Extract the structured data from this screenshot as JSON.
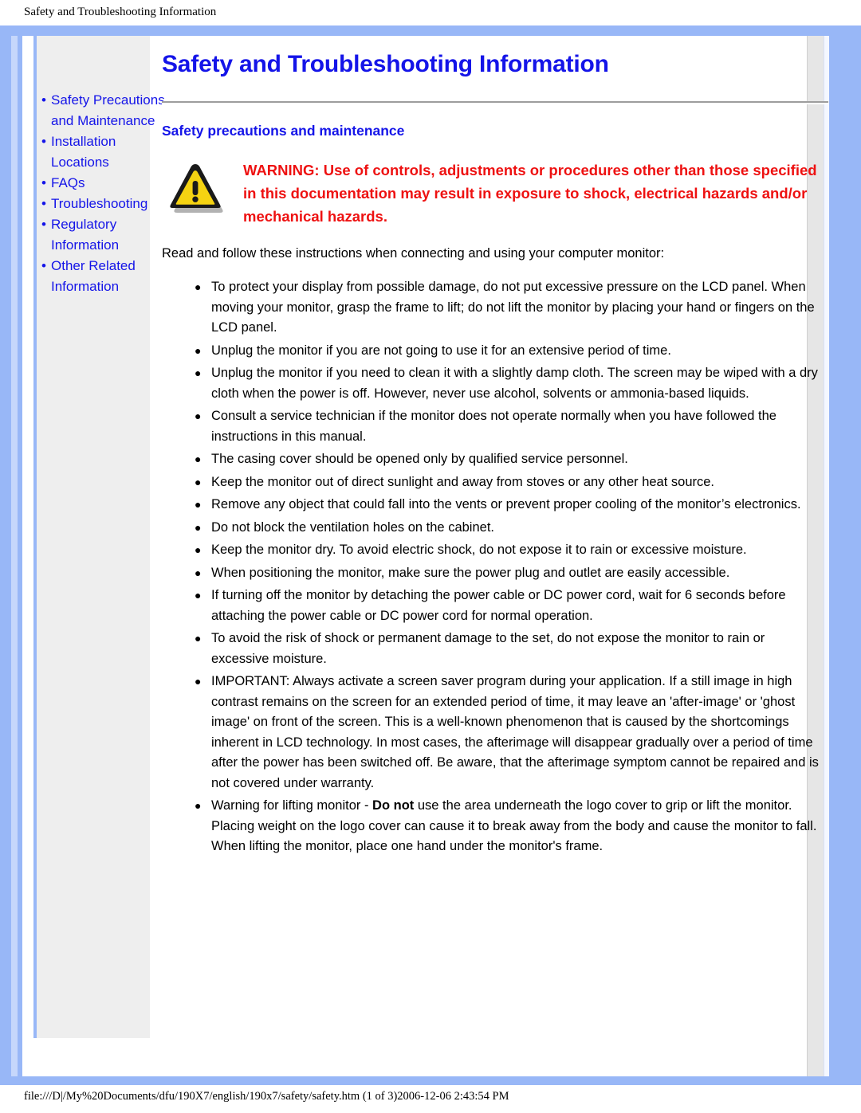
{
  "page": {
    "header_title": "Safety and Troubleshooting Information",
    "footer_path": "file:///D|/My%20Documents/dfu/190X7/english/190x7/safety/safety.htm (1 of 3)2006-12-06 2:43:54 PM"
  },
  "colors": {
    "frame_blue": "#98b7f7",
    "link_blue": "#1414e8",
    "warning_red": "#ee1111",
    "sidebar_gray": "#eeeeee",
    "warn_icon_fill": "#f5d312",
    "warn_icon_stroke": "#1a1a1a"
  },
  "sidebar": {
    "items": [
      {
        "label": "Safety Precautions and Maintenance"
      },
      {
        "label": "Installation Locations"
      },
      {
        "label": "FAQs"
      },
      {
        "label": "Troubleshooting"
      },
      {
        "label": "Regulatory Information"
      },
      {
        "label": "Other Related Information"
      }
    ]
  },
  "main": {
    "title": "Safety and Troubleshooting Information",
    "section_title": "Safety precautions and maintenance",
    "warning": "WARNING: Use of controls, adjustments or procedures other than those specified in this documentation may result in exposure to shock, electrical hazards and/or mechanical hazards.",
    "lead": "Read and follow these instructions when connecting and using your computer monitor:",
    "bullets": [
      "To protect your display from possible damage, do not put excessive pressure on the LCD panel. When moving your monitor, grasp the frame to lift; do not lift the monitor by placing your hand or fingers on the LCD panel.",
      "Unplug the monitor if you are not going to use it for an extensive period of time.",
      "Unplug the monitor if you need to clean it with a slightly damp cloth. The screen may be wiped with a dry cloth when the power is off. However, never use alcohol, solvents or ammonia-based liquids.",
      "Consult a service technician if the monitor does not operate normally when you have followed the instructions in this manual.",
      "The casing cover should be opened only by qualified service personnel.",
      "Keep the monitor out of direct sunlight and away from stoves or any other heat source.",
      "Remove any object that could fall into the vents or prevent proper cooling of the monitor’s electronics.",
      "Do not block the ventilation holes on the cabinet.",
      "Keep the monitor dry. To avoid electric shock, do not expose it to rain or excessive moisture.",
      "When positioning the monitor, make sure the power plug and outlet are easily accessible.",
      "If turning off the monitor by detaching the power cable or DC power cord, wait for 6 seconds before attaching the power cable or DC power cord for normal operation.",
      "To avoid the risk of shock or permanent damage to the set, do not expose the monitor to rain or excessive moisture.",
      "IMPORTANT: Always activate a screen saver program during your application. If a still image in high contrast remains on the screen for an extended period of time, it may leave an 'after-image' or 'ghost image' on front of the screen. This is a well-known phenomenon that is caused by the shortcomings inherent in LCD technology. In most cases, the afterimage will disappear gradually over a period of time after the power has been switched off. Be aware, that the afterimage symptom cannot be repaired and is not covered under warranty."
    ],
    "last_bullet": {
      "prefix": "Warning for lifting monitor - ",
      "emphasis": "Do not",
      "suffix": " use the area underneath the logo cover to grip or lift the monitor. Placing weight on the logo cover can cause it to break away from the body and cause the monitor to fall. When lifting the monitor, place one hand under the monitor's frame."
    }
  },
  "icons": {
    "bullet_glyph": "•",
    "list_dot_glyph": "●"
  }
}
